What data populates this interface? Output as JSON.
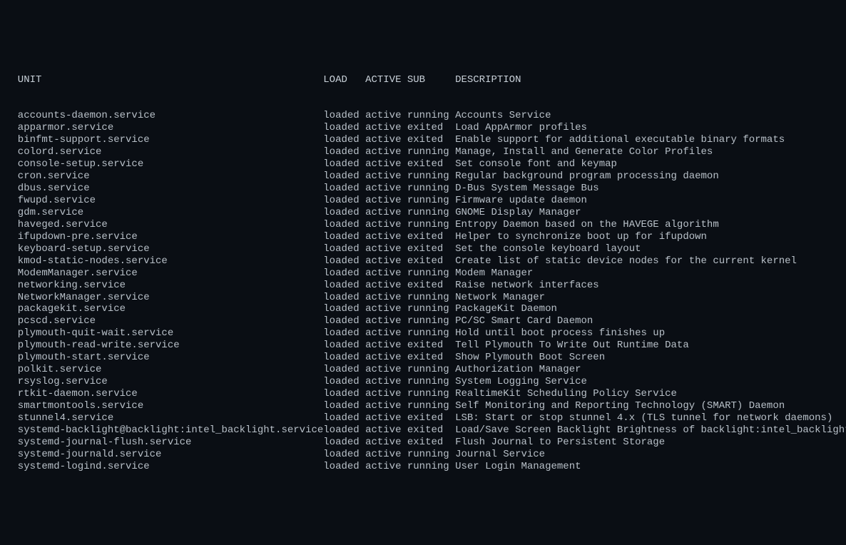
{
  "headers": {
    "unit": "UNIT",
    "load": "LOAD",
    "active": "ACTIVE",
    "sub": "SUB",
    "description": "DESCRIPTION"
  },
  "services": [
    {
      "unit": "accounts-daemon.service",
      "load": "loaded",
      "active": "active",
      "sub": "running",
      "description": "Accounts Service"
    },
    {
      "unit": "apparmor.service",
      "load": "loaded",
      "active": "active",
      "sub": "exited",
      "description": "Load AppArmor profiles"
    },
    {
      "unit": "binfmt-support.service",
      "load": "loaded",
      "active": "active",
      "sub": "exited",
      "description": "Enable support for additional executable binary formats"
    },
    {
      "unit": "colord.service",
      "load": "loaded",
      "active": "active",
      "sub": "running",
      "description": "Manage, Install and Generate Color Profiles"
    },
    {
      "unit": "console-setup.service",
      "load": "loaded",
      "active": "active",
      "sub": "exited",
      "description": "Set console font and keymap"
    },
    {
      "unit": "cron.service",
      "load": "loaded",
      "active": "active",
      "sub": "running",
      "description": "Regular background program processing daemon"
    },
    {
      "unit": "dbus.service",
      "load": "loaded",
      "active": "active",
      "sub": "running",
      "description": "D-Bus System Message Bus"
    },
    {
      "unit": "fwupd.service",
      "load": "loaded",
      "active": "active",
      "sub": "running",
      "description": "Firmware update daemon"
    },
    {
      "unit": "gdm.service",
      "load": "loaded",
      "active": "active",
      "sub": "running",
      "description": "GNOME Display Manager"
    },
    {
      "unit": "haveged.service",
      "load": "loaded",
      "active": "active",
      "sub": "running",
      "description": "Entropy Daemon based on the HAVEGE algorithm"
    },
    {
      "unit": "ifupdown-pre.service",
      "load": "loaded",
      "active": "active",
      "sub": "exited",
      "description": "Helper to synchronize boot up for ifupdown"
    },
    {
      "unit": "keyboard-setup.service",
      "load": "loaded",
      "active": "active",
      "sub": "exited",
      "description": "Set the console keyboard layout"
    },
    {
      "unit": "kmod-static-nodes.service",
      "load": "loaded",
      "active": "active",
      "sub": "exited",
      "description": "Create list of static device nodes for the current kernel"
    },
    {
      "unit": "ModemManager.service",
      "load": "loaded",
      "active": "active",
      "sub": "running",
      "description": "Modem Manager"
    },
    {
      "unit": "networking.service",
      "load": "loaded",
      "active": "active",
      "sub": "exited",
      "description": "Raise network interfaces"
    },
    {
      "unit": "NetworkManager.service",
      "load": "loaded",
      "active": "active",
      "sub": "running",
      "description": "Network Manager"
    },
    {
      "unit": "packagekit.service",
      "load": "loaded",
      "active": "active",
      "sub": "running",
      "description": "PackageKit Daemon"
    },
    {
      "unit": "pcscd.service",
      "load": "loaded",
      "active": "active",
      "sub": "running",
      "description": "PC/SC Smart Card Daemon"
    },
    {
      "unit": "plymouth-quit-wait.service",
      "load": "loaded",
      "active": "active",
      "sub": "running",
      "description": "Hold until boot process finishes up"
    },
    {
      "unit": "plymouth-read-write.service",
      "load": "loaded",
      "active": "active",
      "sub": "exited",
      "description": "Tell Plymouth To Write Out Runtime Data"
    },
    {
      "unit": "plymouth-start.service",
      "load": "loaded",
      "active": "active",
      "sub": "exited",
      "description": "Show Plymouth Boot Screen"
    },
    {
      "unit": "polkit.service",
      "load": "loaded",
      "active": "active",
      "sub": "running",
      "description": "Authorization Manager"
    },
    {
      "unit": "rsyslog.service",
      "load": "loaded",
      "active": "active",
      "sub": "running",
      "description": "System Logging Service"
    },
    {
      "unit": "rtkit-daemon.service",
      "load": "loaded",
      "active": "active",
      "sub": "running",
      "description": "RealtimeKit Scheduling Policy Service"
    },
    {
      "unit": "smartmontools.service",
      "load": "loaded",
      "active": "active",
      "sub": "running",
      "description": "Self Monitoring and Reporting Technology (SMART) Daemon"
    },
    {
      "unit": "stunnel4.service",
      "load": "loaded",
      "active": "active",
      "sub": "exited",
      "description": "LSB: Start or stop stunnel 4.x (TLS tunnel for network daemons)"
    },
    {
      "unit": "systemd-backlight@backlight:intel_backlight.service",
      "load": "loaded",
      "active": "active",
      "sub": "exited",
      "description": "Load/Save Screen Backlight Brightness of backlight:intel_backlight"
    },
    {
      "unit": "systemd-journal-flush.service",
      "load": "loaded",
      "active": "active",
      "sub": "exited",
      "description": "Flush Journal to Persistent Storage"
    },
    {
      "unit": "systemd-journald.service",
      "load": "loaded",
      "active": "active",
      "sub": "running",
      "description": "Journal Service"
    },
    {
      "unit": "systemd-logind.service",
      "load": "loaded",
      "active": "active",
      "sub": "running",
      "description": "User Login Management"
    }
  ]
}
